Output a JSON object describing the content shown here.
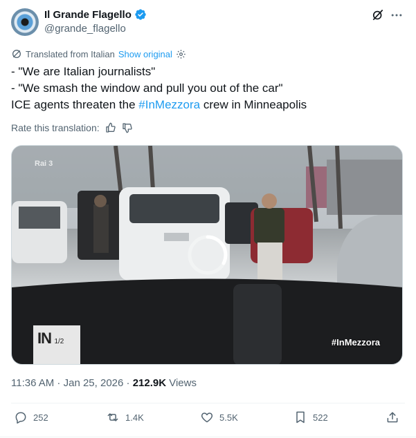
{
  "author": {
    "display_name": "Il Grande Flagello",
    "handle": "@grande_flagello",
    "verified_color": "#1d9bf0"
  },
  "translation": {
    "label": "Translated from Italian",
    "show_original": "Show original",
    "rate_label": "Rate this translation:"
  },
  "post": {
    "line1": "- \"We are Italian journalists\"",
    "line2": "- \"We smash the window and pull you out of the car\"",
    "line3_prefix": "ICE agents threaten the ",
    "hashtag": "#InMezzora",
    "line3_suffix": " crew in Minneapolis"
  },
  "media": {
    "channel_logo": "Rai 3",
    "show_logo_main": "IN",
    "show_logo_fraction": "1/2",
    "overlay_hashtag": "#InMezzora",
    "icon": "video-loading-spinner"
  },
  "meta": {
    "time": "11:36 AM",
    "separator": " · ",
    "date": "Jan 25, 2026",
    "views_count": "212.9K",
    "views_label": " Views"
  },
  "actions": {
    "replies": "252",
    "reposts": "1.4K",
    "likes": "5.5K",
    "bookmarks": "522"
  },
  "colors": {
    "accent": "#1d9bf0",
    "secondary_text": "#536471",
    "primary_text": "#0f1419"
  }
}
